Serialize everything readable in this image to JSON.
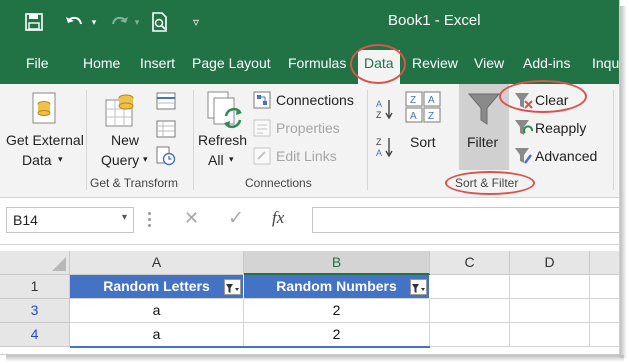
{
  "window": {
    "title": "Book1  -  Excel"
  },
  "tabs": [
    "File",
    "Home",
    "Insert",
    "Page Layout",
    "Formulas",
    "Data",
    "Review",
    "View",
    "Add-ins",
    "Inqu"
  ],
  "ribbon": {
    "get_external": {
      "line1": "Get External",
      "line2": "Data"
    },
    "new_query": {
      "line1": "New",
      "line2": "Query"
    },
    "refresh_all": {
      "line1": "Refresh",
      "line2": "All"
    },
    "connections": "Connections",
    "properties": "Properties",
    "edit_links": "Edit Links",
    "sort": "Sort",
    "filter": "Filter",
    "clear": "Clear",
    "reapply": "Reapply",
    "advanced": "Advanced",
    "groups": {
      "get_transform": "Get & Transform",
      "connections": "Connections",
      "sort_filter": "Sort & Filter"
    }
  },
  "formula_bar": {
    "name_box": "B14",
    "fx": "fx",
    "formula": ""
  },
  "sheet": {
    "columns": [
      "A",
      "B",
      "C",
      "D"
    ],
    "rows": [
      {
        "num": "1",
        "cells": [
          "Random Letters",
          "Random Numbers",
          "",
          ""
        ]
      },
      {
        "num": "3",
        "cells": [
          "a",
          "2",
          "",
          ""
        ]
      },
      {
        "num": "4",
        "cells": [
          "a",
          "2",
          "",
          ""
        ]
      }
    ]
  },
  "colors": {
    "excel_green": "#217346",
    "header_blue": "#4472c4",
    "annotation_red": "#d9534f",
    "filtered_row_number": "#1f4ec9"
  }
}
